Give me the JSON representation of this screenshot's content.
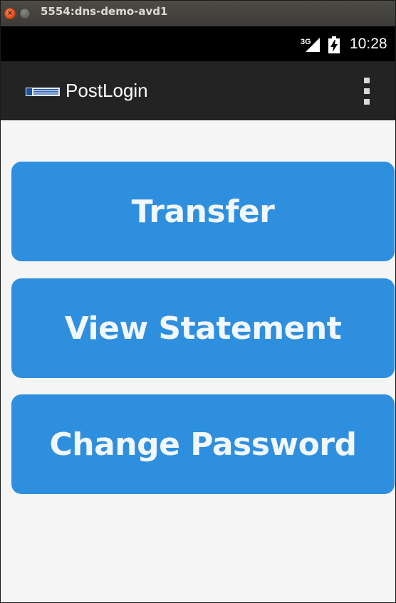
{
  "window": {
    "title": "5554:dns-demo-avd1",
    "close_glyph": "×",
    "close_icon": "close-icon",
    "minimize_icon": "minimize-icon"
  },
  "status_bar": {
    "network_type": "3G",
    "signal_icon": "signal-icon",
    "battery_icon": "battery-icon",
    "time": "10:28"
  },
  "action_bar": {
    "logo_icon": "app-logo-icon",
    "title": "PostLogin",
    "overflow_icon": "overflow-menu-icon"
  },
  "main": {
    "buttons": [
      {
        "label": "Transfer"
      },
      {
        "label": "View Statement"
      },
      {
        "label": "Change Password"
      }
    ]
  },
  "colors": {
    "button_background": "#2f8fdf",
    "action_bar_background": "#232323",
    "status_bar_background": "#000000",
    "content_background": "#f5f5f5"
  }
}
